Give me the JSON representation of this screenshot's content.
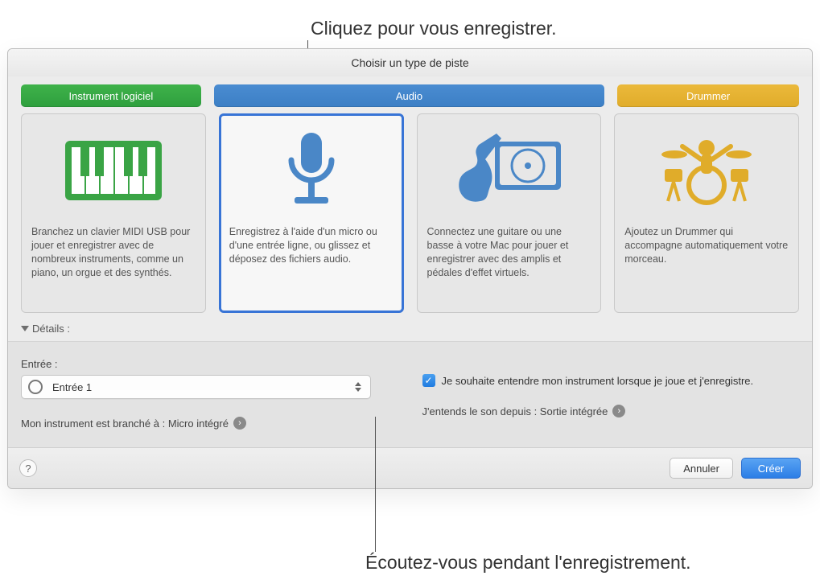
{
  "callouts": {
    "top": "Cliquez pour vous enregistrer.",
    "bottom": "Écoutez-vous pendant l'enregistrement."
  },
  "window": {
    "title": "Choisir un type de piste"
  },
  "tabs": {
    "software": "Instrument logiciel",
    "audio": "Audio",
    "drummer": "Drummer"
  },
  "cards": {
    "software": {
      "desc": "Branchez un clavier MIDI USB pour jouer et enregistrer avec de nombreux instruments, comme un piano, un orgue et des synthés."
    },
    "mic": {
      "desc": "Enregistrez à l'aide d'un micro ou d'une entrée ligne, ou glissez et déposez des fichiers audio."
    },
    "guitar": {
      "desc": "Connectez une guitare ou une basse à votre Mac pour jouer et enregistrer avec des amplis et pédales d'effet virtuels."
    },
    "drummer": {
      "desc": "Ajoutez un Drummer qui accompagne automatiquement votre morceau."
    }
  },
  "details": {
    "header": "Détails :",
    "input_label": "Entrée :",
    "input_value": "Entrée 1",
    "monitor_label": "Je souhaite entendre mon instrument lorsque je joue et j'enregistre.",
    "connected_label": "Mon instrument est branché à : Micro intégré",
    "output_label": "J'entends le son depuis : Sortie intégrée"
  },
  "footer": {
    "help": "?",
    "cancel": "Annuler",
    "create": "Créer"
  }
}
